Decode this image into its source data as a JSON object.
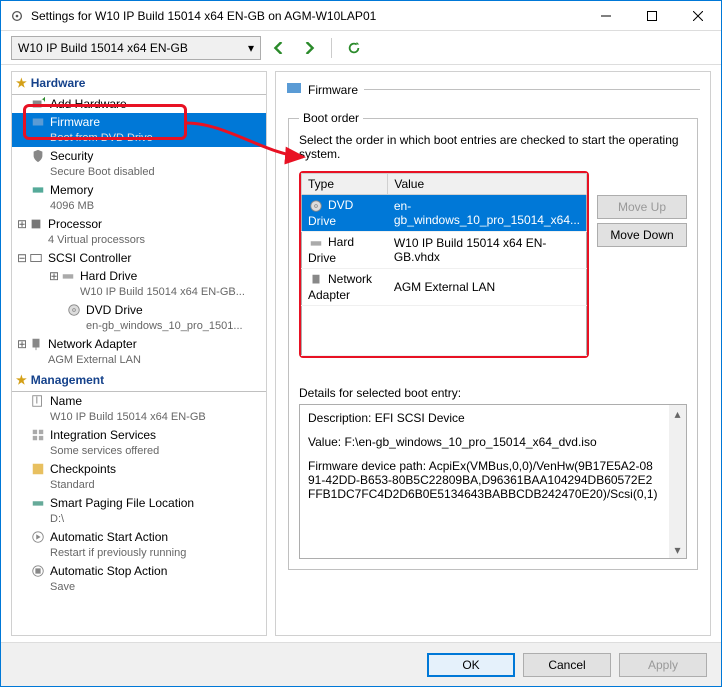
{
  "title": "Settings for W10 IP Build 15014 x64 EN-GB on AGM-W10LAP01",
  "vm_selector": "W10 IP Build 15014 x64 EN-GB",
  "sections": {
    "hardware": "Hardware",
    "management": "Management"
  },
  "tree": {
    "add_hw": "Add Hardware",
    "firmware": {
      "label": "Firmware",
      "sub": "Boot from DVD Drive"
    },
    "security": {
      "label": "Security",
      "sub": "Secure Boot disabled"
    },
    "memory": {
      "label": "Memory",
      "sub": "4096 MB"
    },
    "processor": {
      "label": "Processor",
      "sub": "4 Virtual processors"
    },
    "scsi": {
      "label": "SCSI Controller"
    },
    "hard_drive": {
      "label": "Hard Drive",
      "sub": "W10 IP Build 15014 x64 EN-GB..."
    },
    "dvd_drive": {
      "label": "DVD Drive",
      "sub": "en-gb_windows_10_pro_1501..."
    },
    "net_adapter": {
      "label": "Network Adapter",
      "sub": "AGM External LAN"
    },
    "name": {
      "label": "Name",
      "sub": "W10 IP Build 15014 x64 EN-GB"
    },
    "integration": {
      "label": "Integration Services",
      "sub": "Some services offered"
    },
    "checkpoints": {
      "label": "Checkpoints",
      "sub": "Standard"
    },
    "paging": {
      "label": "Smart Paging File Location",
      "sub": "D:\\"
    },
    "auto_start": {
      "label": "Automatic Start Action",
      "sub": "Restart if previously running"
    },
    "auto_stop": {
      "label": "Automatic Stop Action",
      "sub": "Save"
    }
  },
  "main": {
    "header": "Firmware",
    "boot_legend": "Boot order",
    "boot_desc": "Select the order in which boot entries are checked to start the operating system.",
    "col_type": "Type",
    "col_value": "Value",
    "rows": [
      {
        "type": "DVD Drive",
        "value": "en-gb_windows_10_pro_15014_x64..."
      },
      {
        "type": "Hard Drive",
        "value": "W10 IP Build 15014 x64 EN-GB.vhdx"
      },
      {
        "type": "Network Adapter",
        "value": "AGM External LAN"
      }
    ],
    "move_up": "Move Up",
    "move_down": "Move Down",
    "details_label": "Details for selected boot entry:",
    "details_desc": "Description: EFI SCSI Device",
    "details_value": "Value: F:\\en-gb_windows_10_pro_15014_x64_dvd.iso",
    "details_path": "Firmware device path: AcpiEx(VMBus,0,0)/VenHw(9B17E5A2-0891-42DD-B653-80B5C22809BA,D96361BAA104294DB60572E2FFB1DC7FC4D2D6B0E5134643BABBCDB242470E20)/Scsi(0,1)"
  },
  "footer": {
    "ok": "OK",
    "cancel": "Cancel",
    "apply": "Apply"
  }
}
